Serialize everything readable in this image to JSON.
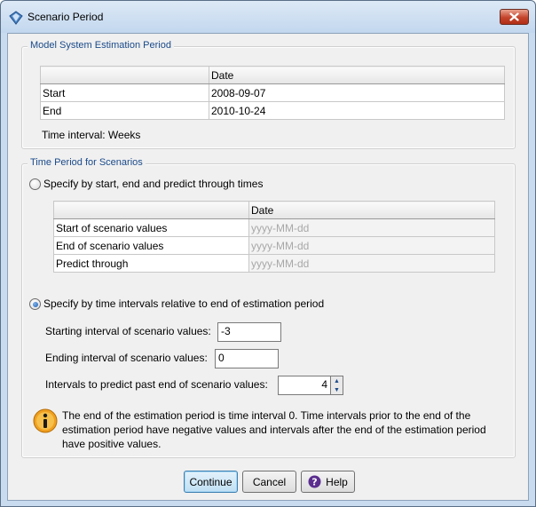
{
  "window": {
    "title": "Scenario Period",
    "icon": "diamond-app-icon"
  },
  "estimation": {
    "legend": "Model System Estimation Period",
    "date_header": "Date",
    "rows": [
      {
        "label": "Start",
        "date": "2008-09-07"
      },
      {
        "label": "End",
        "date": "2010-10-24"
      }
    ],
    "time_interval": "Time interval: Weeks"
  },
  "scenario": {
    "legend": "Time Period for Scenarios",
    "option1_label": "Specify by start, end and predict through times",
    "option1_checked": false,
    "date_header": "Date",
    "rows": [
      {
        "label": "Start of scenario values",
        "placeholder": "yyyy-MM-dd"
      },
      {
        "label": "End of scenario values",
        "placeholder": "yyyy-MM-dd"
      },
      {
        "label": "Predict through",
        "placeholder": "yyyy-MM-dd"
      }
    ],
    "option2_label": "Specify by time intervals relative to end of estimation period",
    "option2_checked": true,
    "starting_label": "Starting interval of scenario values:",
    "starting_value": "-3",
    "ending_label": "Ending interval of scenario values:",
    "ending_value": "0",
    "predict_label": "Intervals to predict past end of scenario values:",
    "predict_value": "4",
    "info_text": "The end of the estimation period is time interval 0. Time intervals prior to the end of the estimation period have negative values and intervals after the end of the estimation period have positive values."
  },
  "buttons": {
    "continue": "Continue",
    "cancel": "Cancel",
    "help": "Help"
  },
  "colors": {
    "legend_text": "#1a4a8a",
    "close_button": "#c4432b",
    "info_icon": "#f0a020",
    "default_button": "#bfdff3"
  }
}
